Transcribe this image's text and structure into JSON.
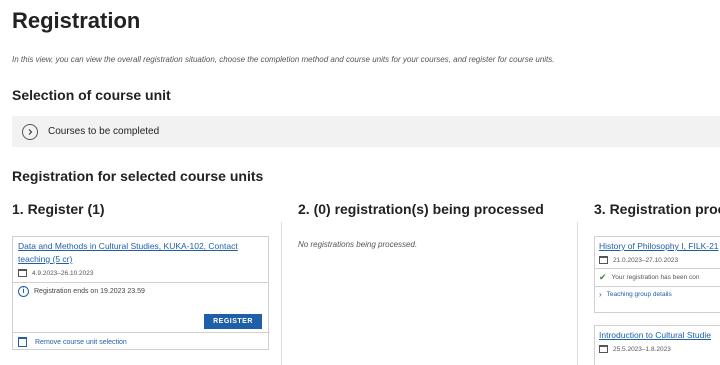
{
  "page": {
    "title": "Registration",
    "intro": "In this view, you can view the overall registration situation, choose the completion method and course units for your courses, and register for course units."
  },
  "selection": {
    "heading": "Selection of course unit",
    "expander_label": "Courses to be completed"
  },
  "registration": {
    "heading": "Registration for selected course units",
    "columns": {
      "register_title": "1. Register (1)",
      "processing_title": "2. (0) registration(s) being processed",
      "processing_empty": "No registrations being processed.",
      "processed_title": "3. Registration proc"
    }
  },
  "register_card": {
    "course_link_line1": "Data and Methods in Cultural Studies, KUKA-102, Contact",
    "course_link_line2": "teaching (5 cr)",
    "dates": "4.9.2023–26.10.2023",
    "registration_ends": "Registration ends on 19.2023 23.59",
    "register_button": "REGISTER",
    "remove_label": "Remove course unit selection"
  },
  "processed_cards": [
    {
      "course_link": "History of Philosophy I, FILK-21",
      "dates": "21.0.2023–27.10.2023",
      "status": "Your registration has been con",
      "group_details": "Teaching group details"
    },
    {
      "course_link": "Introduction to Cultural Studie",
      "dates": "25.5.2023–1.8.2023"
    }
  ],
  "colors": {
    "link": "#1f5fa8",
    "button": "#1f5fa8",
    "success": "#2e8b3a",
    "panel_bg": "#f2f2f2"
  },
  "icons": {
    "expander": "chevron-right-circle-icon",
    "calendar": "calendar-icon",
    "info": "info-icon",
    "trash": "trash-icon",
    "check": "checkmark-icon",
    "chevron": "chevron-right-icon"
  }
}
